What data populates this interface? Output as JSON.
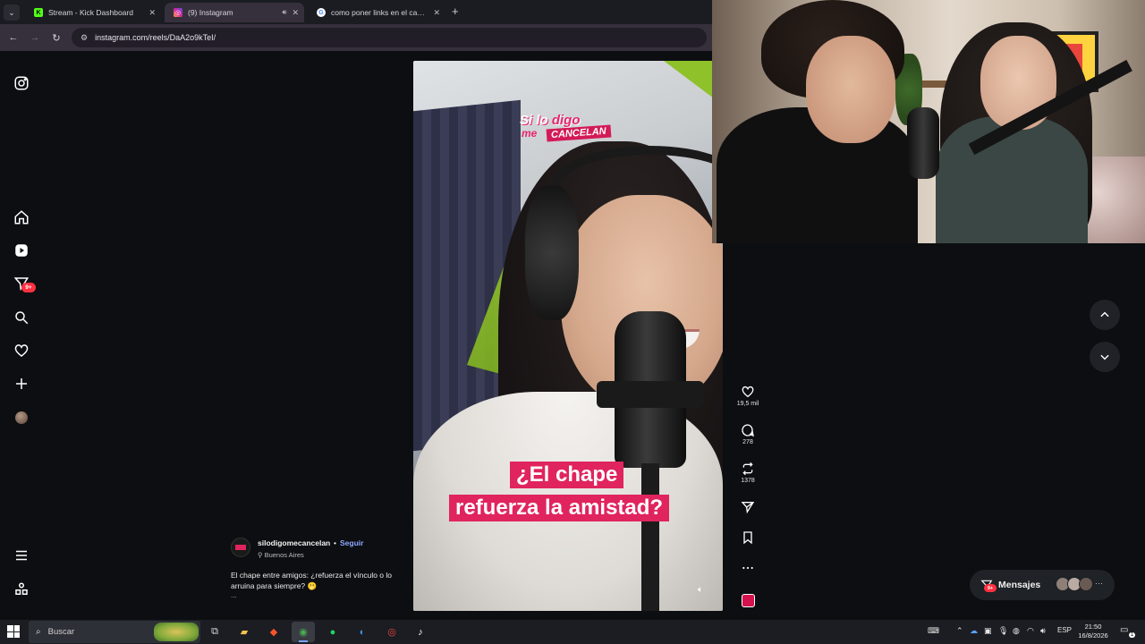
{
  "browser": {
    "tabs": [
      {
        "title": "Stream - Kick Dashboard",
        "favicon": "kick-icon",
        "active": false
      },
      {
        "title": "(9) Instagram",
        "favicon": "instagram-icon",
        "active": true
      },
      {
        "title": "como poner links en el canal d",
        "favicon": "google-icon",
        "active": false
      }
    ],
    "url": "instagram.com/reels/DaA2o9kTeI/"
  },
  "sidebar": {
    "notifications_badge": "9+"
  },
  "reel": {
    "show_logo": {
      "part1": "Si lo ",
      "part1_highlight": "digo",
      "part2": "me",
      "part3": "CANCELAN"
    },
    "caption_line1": "¿El chape",
    "caption_line2": "refuerza la amistad?",
    "likes": "19,5 mil",
    "comments": "278",
    "reposts": "1378"
  },
  "post": {
    "username": "silodigomecancelan",
    "separator": "•",
    "follow_label": "Seguir",
    "location": "Buenos Aires",
    "description": "El chape entre amigos: ¿refuerza el vínculo o lo arruina para siempre? 🫢",
    "more": "..."
  },
  "messages": {
    "label": "Mensajes",
    "badge": "9+",
    "more": "···"
  },
  "taskbar": {
    "search_placeholder": "Buscar",
    "language": "ESP",
    "time": "21:50",
    "date": "16/8/2026",
    "notifications": "1"
  },
  "colors": {
    "instagram_dark": "#0c0e11",
    "caption_pink": "#e0245e",
    "follow_blue": "#8fa8ff",
    "badge_red": "#ff3040"
  }
}
